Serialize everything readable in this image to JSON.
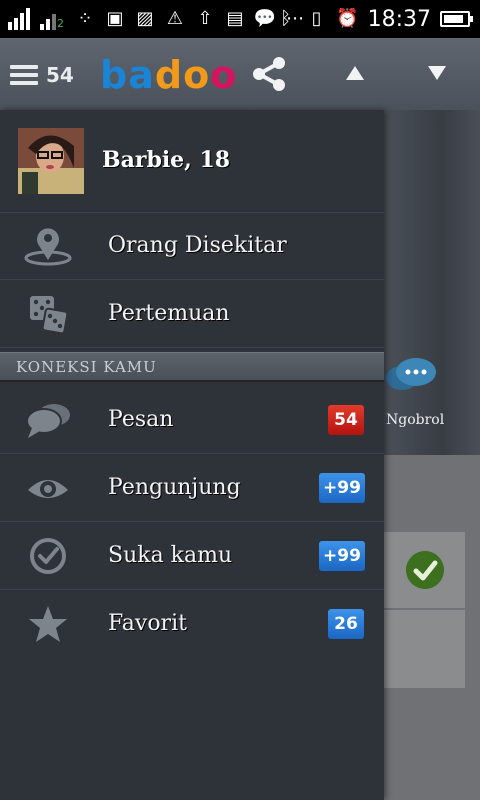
{
  "status_bar": {
    "time": "18:37",
    "signal_badge": "2",
    "battery_level": 0.85
  },
  "app_bar": {
    "menu_count": "54",
    "logo": "badoo",
    "logo_colors": [
      "#1a84d6",
      "#1a84d6",
      "#f29a1a",
      "#f29a1a",
      "#d5135e"
    ]
  },
  "drawer": {
    "profile": {
      "name": "Barbie, 18"
    },
    "top_items": [
      {
        "label": "Orang Disekitar",
        "icon": "location-pin-icon"
      },
      {
        "label": "Pertemuan",
        "icon": "dice-icon"
      }
    ],
    "section_title": "KONEKSI KAMU",
    "connection_items": [
      {
        "label": "Pesan",
        "icon": "chat-icon",
        "badge": "54",
        "badge_color": "#d42018"
      },
      {
        "label": "Pengunjung",
        "icon": "eye-icon",
        "badge": "+99",
        "badge_color": "#2a7ad6"
      },
      {
        "label": "Suka kamu",
        "icon": "check-circle-icon",
        "badge": "+99",
        "badge_color": "#2a7ad6"
      },
      {
        "label": "Favorit",
        "icon": "star-icon",
        "badge": "26",
        "badge_color": "#2a7ad6"
      }
    ]
  },
  "background": {
    "chat_label": "Ngobrol"
  }
}
